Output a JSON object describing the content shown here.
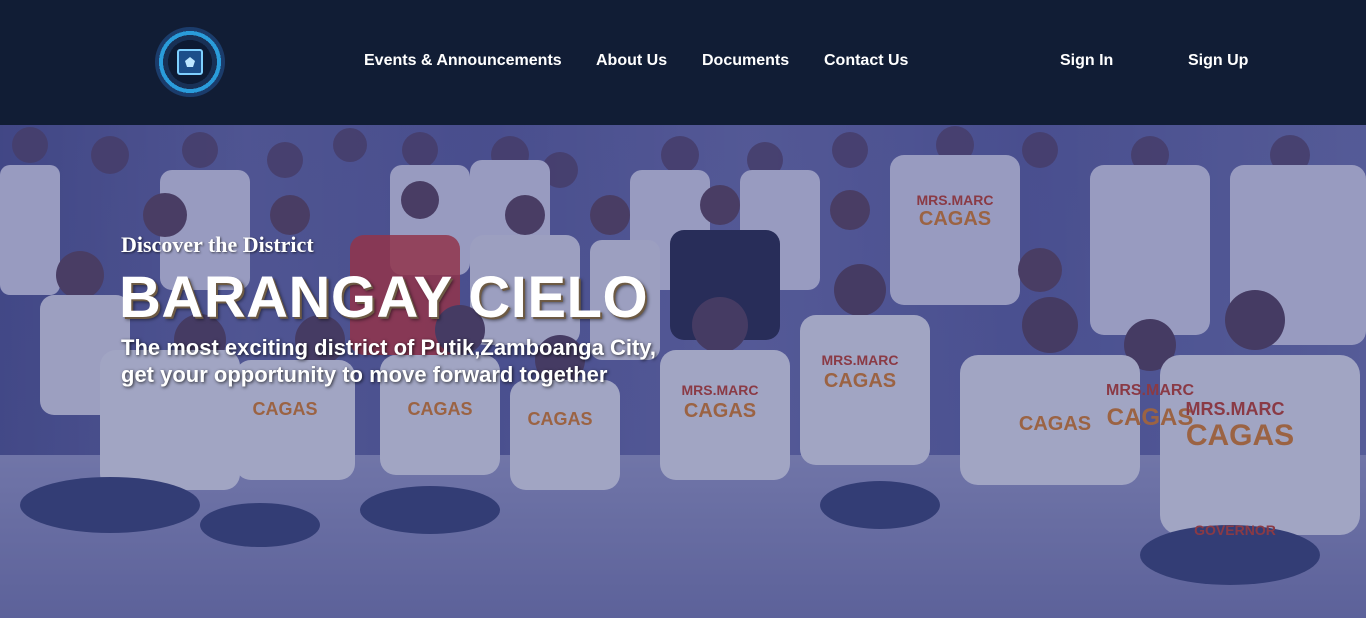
{
  "nav": {
    "links": [
      "Events & Announcements",
      "About Us",
      "Documents",
      "Contact Us"
    ],
    "sign_in": "Sign In",
    "sign_up": "Sign Up"
  },
  "hero": {
    "eyebrow": "Discover the District",
    "title": "BARANGAY CIELO",
    "subtitle_line1": "The most exciting district of Putik,Zamboanga City,",
    "subtitle_line2": "get your opportunity to move forward together",
    "shirt_text_top": "MRS.MARC",
    "shirt_text_main": "CAGAS",
    "shirt_text_bottom": "GOVERNOR"
  },
  "colors": {
    "navbar_bg": "#111d35",
    "text": "#ffffff",
    "logo_ring": "#2a9cdb"
  },
  "icons": {
    "logo": "circuit-chip-seal-logo"
  }
}
